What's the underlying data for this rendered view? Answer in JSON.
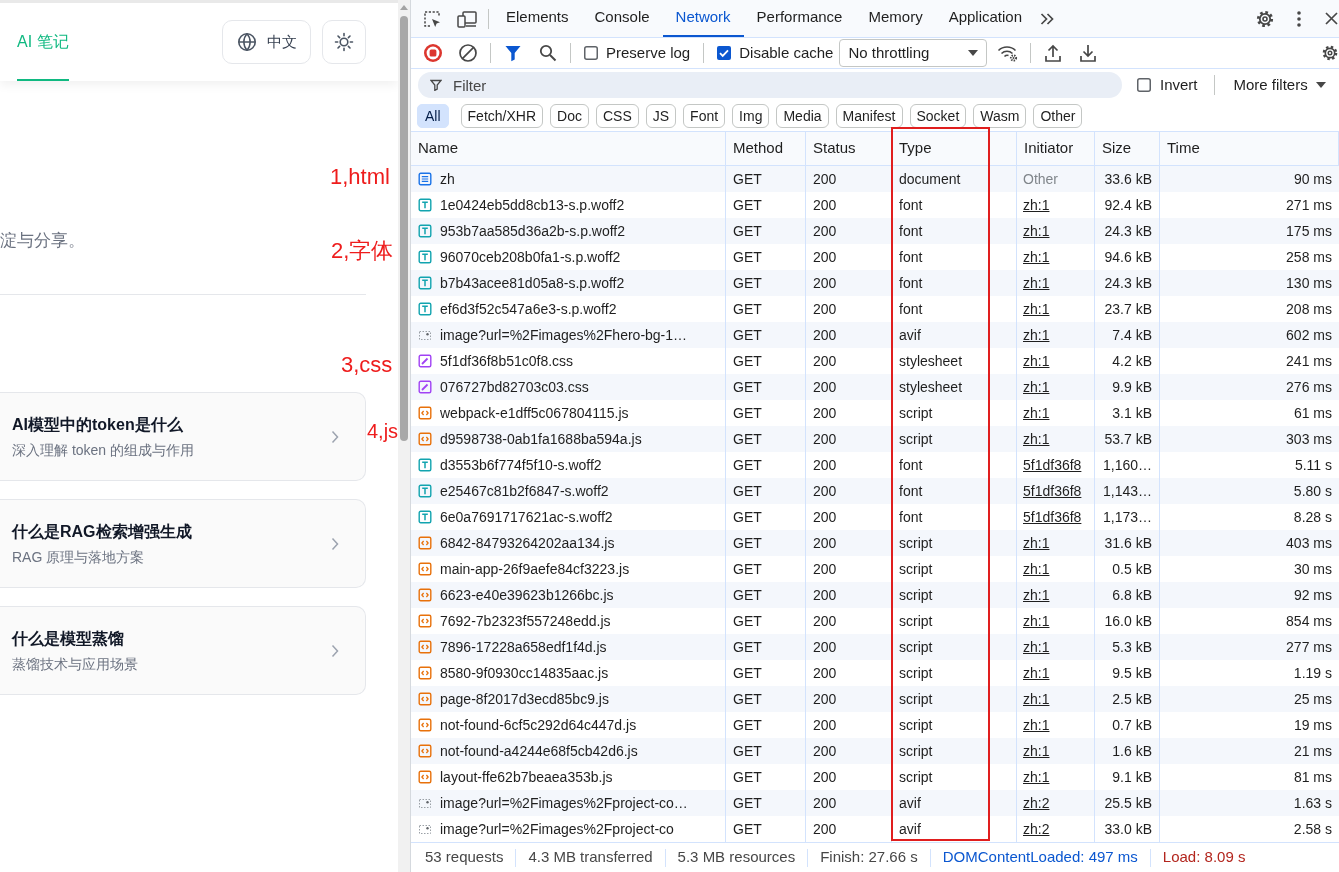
{
  "page": {
    "nav": [
      {
        "label": "AI 笔记",
        "selected": true
      }
    ],
    "language_button": {
      "label": "中文"
    },
    "intro_text": "淀与分享。",
    "cards": [
      {
        "title": "AI模型中的token是什么",
        "subtitle": "深入理解 token 的组成与作用"
      },
      {
        "title": "什么是RAG检索增强生成",
        "subtitle": "RAG 原理与落地方案"
      },
      {
        "title": "什么是模型蒸馏",
        "subtitle": "蒸馏技术与应用场景"
      }
    ]
  },
  "annotations": [
    "1,html",
    "2,字体",
    "3,css",
    "4,js"
  ],
  "devtools": {
    "tabs": [
      {
        "label": "Elements",
        "selected": false
      },
      {
        "label": "Console",
        "selected": false
      },
      {
        "label": "Network",
        "selected": true
      },
      {
        "label": "Performance",
        "selected": false
      },
      {
        "label": "Memory",
        "selected": false
      },
      {
        "label": "Application",
        "selected": false
      }
    ],
    "toolbar": {
      "checkboxes": [
        {
          "label": "Preserve log",
          "checked": false
        },
        {
          "label": "Disable cache",
          "checked": true
        }
      ],
      "throttling": {
        "value": "No throttling"
      }
    },
    "filter": {
      "placeholder": "Filter",
      "invert": {
        "label": "Invert",
        "checked": false
      },
      "more_filters": "More filters"
    },
    "type_filters": [
      {
        "label": "All",
        "selected": true
      },
      {
        "label": "Fetch/XHR",
        "selected": false
      },
      {
        "label": "Doc",
        "selected": false
      },
      {
        "label": "CSS",
        "selected": false
      },
      {
        "label": "JS",
        "selected": false
      },
      {
        "label": "Font",
        "selected": false
      },
      {
        "label": "Img",
        "selected": false
      },
      {
        "label": "Media",
        "selected": false
      },
      {
        "label": "Manifest",
        "selected": false
      },
      {
        "label": "Socket",
        "selected": false
      },
      {
        "label": "Wasm",
        "selected": false
      },
      {
        "label": "Other",
        "selected": false
      }
    ],
    "table": {
      "columns": [
        {
          "label": "Name",
          "highlighted": false
        },
        {
          "label": "Method",
          "highlighted": false
        },
        {
          "label": "Status",
          "highlighted": false
        },
        {
          "label": "Type",
          "highlighted": true
        },
        {
          "label": "Initiator",
          "highlighted": false
        },
        {
          "label": "Size",
          "highlighted": false
        },
        {
          "label": "Time",
          "highlighted": false
        }
      ],
      "rows": [
        {
          "kind": "document",
          "name": "zh",
          "method": "GET",
          "status": "200",
          "type": "document",
          "initiator": "Other",
          "initiator_link": false,
          "size": "33.6 kB",
          "time": "90 ms"
        },
        {
          "kind": "font",
          "name": "1e0424eb5dd8cb13-s.p.woff2",
          "method": "GET",
          "status": "200",
          "type": "font",
          "initiator": "zh:1",
          "initiator_link": true,
          "size": "92.4 kB",
          "time": "271 ms"
        },
        {
          "kind": "font",
          "name": "953b7aa585d36a2b-s.p.woff2",
          "method": "GET",
          "status": "200",
          "type": "font",
          "initiator": "zh:1",
          "initiator_link": true,
          "size": "24.3 kB",
          "time": "175 ms"
        },
        {
          "kind": "font",
          "name": "96070ceb208b0fa1-s.p.woff2",
          "method": "GET",
          "status": "200",
          "type": "font",
          "initiator": "zh:1",
          "initiator_link": true,
          "size": "94.6 kB",
          "time": "258 ms"
        },
        {
          "kind": "font",
          "name": "b7b43acee81d05a8-s.p.woff2",
          "method": "GET",
          "status": "200",
          "type": "font",
          "initiator": "zh:1",
          "initiator_link": true,
          "size": "24.3 kB",
          "time": "130 ms"
        },
        {
          "kind": "font",
          "name": "ef6d3f52c547a6e3-s.p.woff2",
          "method": "GET",
          "status": "200",
          "type": "font",
          "initiator": "zh:1",
          "initiator_link": true,
          "size": "23.7 kB",
          "time": "208 ms"
        },
        {
          "kind": "image",
          "name": "image?url=%2Fimages%2Fhero-bg-1…",
          "method": "GET",
          "status": "200",
          "type": "avif",
          "initiator": "zh:1",
          "initiator_link": true,
          "size": "7.4 kB",
          "time": "602 ms"
        },
        {
          "kind": "stylesheet",
          "name": "5f1df36f8b51c0f8.css",
          "method": "GET",
          "status": "200",
          "type": "stylesheet",
          "initiator": "zh:1",
          "initiator_link": true,
          "size": "4.2 kB",
          "time": "241 ms"
        },
        {
          "kind": "stylesheet",
          "name": "076727bd82703c03.css",
          "method": "GET",
          "status": "200",
          "type": "stylesheet",
          "initiator": "zh:1",
          "initiator_link": true,
          "size": "9.9 kB",
          "time": "276 ms"
        },
        {
          "kind": "script",
          "name": "webpack-e1dff5c067804115.js",
          "method": "GET",
          "status": "200",
          "type": "script",
          "initiator": "zh:1",
          "initiator_link": true,
          "size": "3.1 kB",
          "time": "61 ms"
        },
        {
          "kind": "script",
          "name": "d9598738-0ab1fa1688ba594a.js",
          "method": "GET",
          "status": "200",
          "type": "script",
          "initiator": "zh:1",
          "initiator_link": true,
          "size": "53.7 kB",
          "time": "303 ms"
        },
        {
          "kind": "font",
          "name": "d3553b6f774f5f10-s.woff2",
          "method": "GET",
          "status": "200",
          "type": "font",
          "initiator": "5f1df36f8",
          "initiator_link": true,
          "size": "1,160…",
          "time": "5.11 s"
        },
        {
          "kind": "font",
          "name": "e25467c81b2f6847-s.woff2",
          "method": "GET",
          "status": "200",
          "type": "font",
          "initiator": "5f1df36f8",
          "initiator_link": true,
          "size": "1,143…",
          "time": "5.80 s"
        },
        {
          "kind": "font",
          "name": "6e0a7691717621ac-s.woff2",
          "method": "GET",
          "status": "200",
          "type": "font",
          "initiator": "5f1df36f8",
          "initiator_link": true,
          "size": "1,173…",
          "time": "8.28 s"
        },
        {
          "kind": "script",
          "name": "6842-84793264202aa134.js",
          "method": "GET",
          "status": "200",
          "type": "script",
          "initiator": "zh:1",
          "initiator_link": true,
          "size": "31.6 kB",
          "time": "403 ms"
        },
        {
          "kind": "script",
          "name": "main-app-26f9aefe84cf3223.js",
          "method": "GET",
          "status": "200",
          "type": "script",
          "initiator": "zh:1",
          "initiator_link": true,
          "size": "0.5 kB",
          "time": "30 ms"
        },
        {
          "kind": "script",
          "name": "6623-e40e39623b1266bc.js",
          "method": "GET",
          "status": "200",
          "type": "script",
          "initiator": "zh:1",
          "initiator_link": true,
          "size": "6.8 kB",
          "time": "92 ms"
        },
        {
          "kind": "script",
          "name": "7692-7b2323f557248edd.js",
          "method": "GET",
          "status": "200",
          "type": "script",
          "initiator": "zh:1",
          "initiator_link": true,
          "size": "16.0 kB",
          "time": "854 ms"
        },
        {
          "kind": "script",
          "name": "7896-17228a658edf1f4d.js",
          "method": "GET",
          "status": "200",
          "type": "script",
          "initiator": "zh:1",
          "initiator_link": true,
          "size": "5.3 kB",
          "time": "277 ms"
        },
        {
          "kind": "script",
          "name": "8580-9f0930cc14835aac.js",
          "method": "GET",
          "status": "200",
          "type": "script",
          "initiator": "zh:1",
          "initiator_link": true,
          "size": "9.5 kB",
          "time": "1.19 s"
        },
        {
          "kind": "script",
          "name": "page-8f2017d3ecd85bc9.js",
          "method": "GET",
          "status": "200",
          "type": "script",
          "initiator": "zh:1",
          "initiator_link": true,
          "size": "2.5 kB",
          "time": "25 ms"
        },
        {
          "kind": "script",
          "name": "not-found-6cf5c292d64c447d.js",
          "method": "GET",
          "status": "200",
          "type": "script",
          "initiator": "zh:1",
          "initiator_link": true,
          "size": "0.7 kB",
          "time": "19 ms"
        },
        {
          "kind": "script",
          "name": "not-found-a4244e68f5cb42d6.js",
          "method": "GET",
          "status": "200",
          "type": "script",
          "initiator": "zh:1",
          "initiator_link": true,
          "size": "1.6 kB",
          "time": "21 ms"
        },
        {
          "kind": "script",
          "name": "layout-ffe62b7beaea353b.js",
          "method": "GET",
          "status": "200",
          "type": "script",
          "initiator": "zh:1",
          "initiator_link": true,
          "size": "9.1 kB",
          "time": "81 ms"
        },
        {
          "kind": "image",
          "name": "image?url=%2Fimages%2Fproject-co…",
          "method": "GET",
          "status": "200",
          "type": "avif",
          "initiator": "zh:2",
          "initiator_link": true,
          "size": "25.5 kB",
          "time": "1.63 s"
        },
        {
          "kind": "image",
          "name": "image?url=%2Fimages%2Fproject-co",
          "method": "GET",
          "status": "200",
          "type": "avif",
          "initiator": "zh:2",
          "initiator_link": true,
          "size": "33.0 kB",
          "time": "2.58 s"
        }
      ]
    },
    "status_bar": [
      {
        "kind": "plain",
        "text": "53 requests"
      },
      {
        "kind": "plain",
        "text": "4.3 MB transferred"
      },
      {
        "kind": "plain",
        "text": "5.3 MB resources"
      },
      {
        "kind": "plain",
        "text": "Finish: 27.66 s"
      },
      {
        "kind": "dom_loaded",
        "text": "DOMContentLoaded: 497 ms"
      },
      {
        "kind": "load",
        "text": "Load: 8.09 s"
      }
    ]
  }
}
